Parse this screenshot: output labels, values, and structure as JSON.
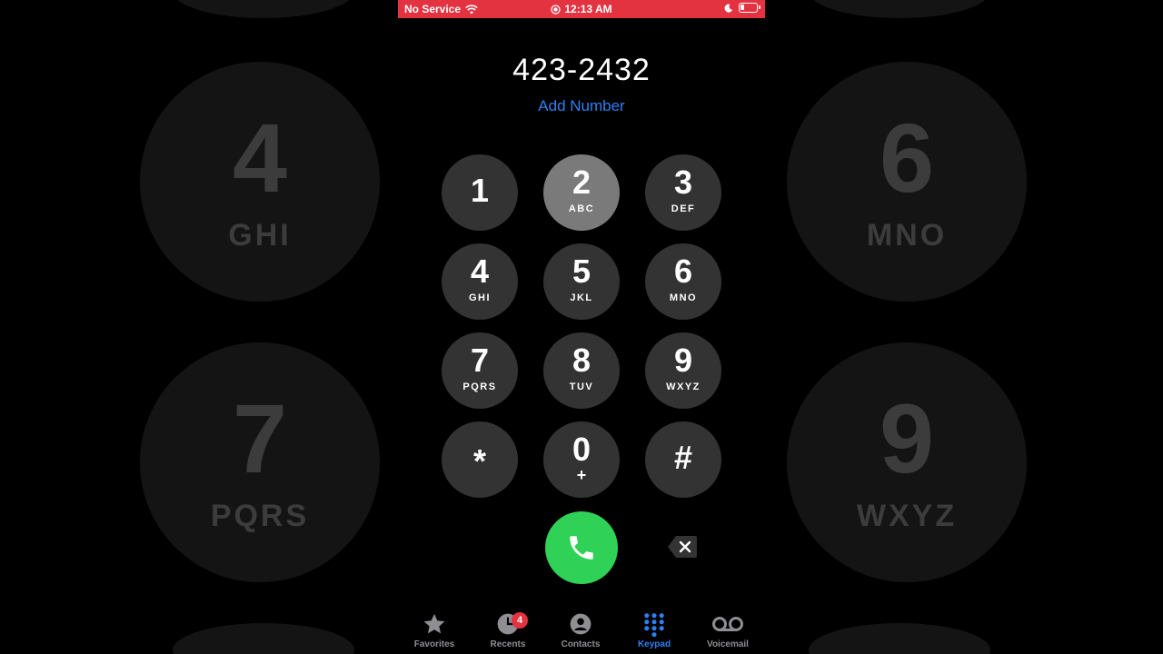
{
  "status_bar": {
    "carrier": "No Service",
    "time": "12:13 AM"
  },
  "dialer": {
    "number": "423-2432",
    "add_number_label": "Add Number"
  },
  "keys": [
    {
      "digit": "1",
      "letters": ""
    },
    {
      "digit": "2",
      "letters": "ABC"
    },
    {
      "digit": "3",
      "letters": "DEF"
    },
    {
      "digit": "4",
      "letters": "GHI"
    },
    {
      "digit": "5",
      "letters": "JKL"
    },
    {
      "digit": "6",
      "letters": "MNO"
    },
    {
      "digit": "7",
      "letters": "PQRS"
    },
    {
      "digit": "8",
      "letters": "TUV"
    },
    {
      "digit": "9",
      "letters": "WXYZ"
    },
    {
      "digit": "*",
      "letters": ""
    },
    {
      "digit": "0",
      "letters": "+"
    },
    {
      "digit": "#",
      "letters": ""
    }
  ],
  "background_keys": [
    {
      "digit": "4",
      "letters": "GHI"
    },
    {
      "digit": "6",
      "letters": "MNO"
    },
    {
      "digit": "7",
      "letters": "PQRS"
    },
    {
      "digit": "9",
      "letters": "WXYZ"
    }
  ],
  "tabs": [
    {
      "label": "Favorites",
      "icon": "star-icon"
    },
    {
      "label": "Recents",
      "icon": "clock-icon",
      "badge": "4"
    },
    {
      "label": "Contacts",
      "icon": "person-circle-icon"
    },
    {
      "label": "Keypad",
      "icon": "keypad-grid-icon",
      "selected": true
    },
    {
      "label": "Voicemail",
      "icon": "voicemail-icon"
    }
  ],
  "colors": {
    "status_bar_red": "#e33240",
    "accent_blue": "#2f7ff0",
    "call_green": "#2fd156",
    "key_gray": "#333333",
    "key_pressed": "#7a7a7a"
  }
}
